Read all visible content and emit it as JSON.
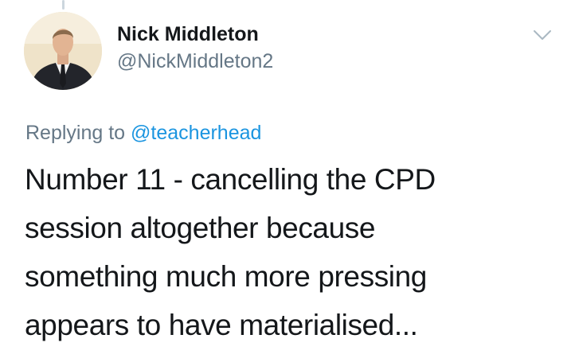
{
  "author": {
    "display_name": "Nick Middleton",
    "handle": "@NickMiddleton2"
  },
  "reply": {
    "prefix": "Replying to",
    "mention": "@teacherhead"
  },
  "tweet": {
    "lines": [
      "Number 11 - cancelling the CPD",
      "session altogether because",
      "something much more pressing",
      "appears to have materialised..."
    ]
  },
  "icons": {
    "menu": "chevron-down-icon",
    "avatar": "profile-photo"
  },
  "colors": {
    "text": "#14171a",
    "secondary": "#657786",
    "link": "#1b95e0",
    "thread_line": "#ccd6dd"
  }
}
